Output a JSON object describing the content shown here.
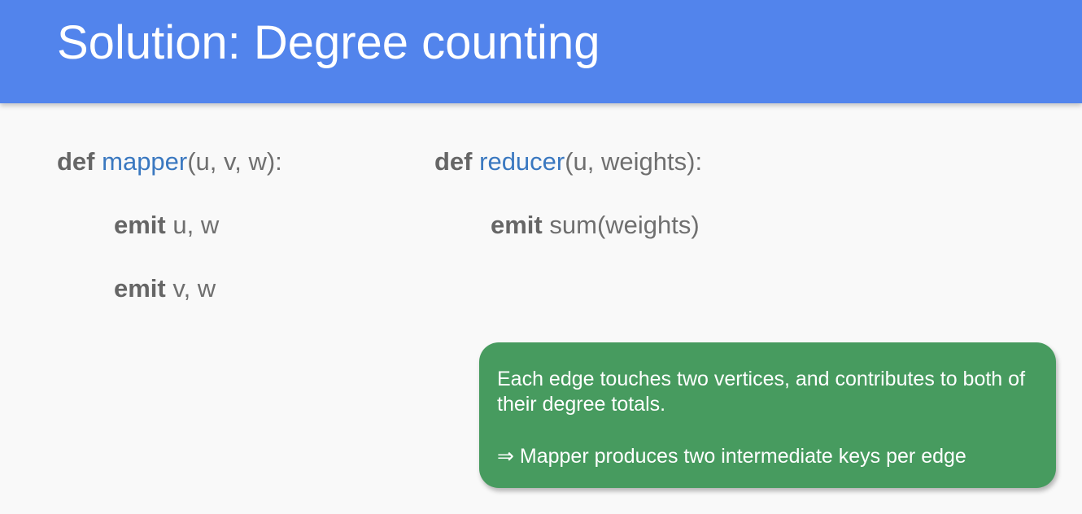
{
  "slide": {
    "title": "Solution: Degree counting"
  },
  "mapper": {
    "def_keyword": "def",
    "name": "mapper",
    "params": "(u, v, w):",
    "lines": [
      {
        "keyword": "emit",
        "args": "u, w"
      },
      {
        "keyword": "emit",
        "args": "v, w"
      }
    ]
  },
  "reducer": {
    "def_keyword": "def",
    "name": "reducer",
    "params": "(u, weights):",
    "lines": [
      {
        "keyword": "emit",
        "args": "sum(weights)"
      }
    ]
  },
  "callout": {
    "text": "Each edge touches two vertices, and contributes to both of their degree totals.",
    "note": "⇒ Mapper produces two intermediate keys per edge"
  },
  "colors": {
    "header": "#5284ec",
    "function_name": "#3a78c0",
    "callout": "#479b5f"
  }
}
